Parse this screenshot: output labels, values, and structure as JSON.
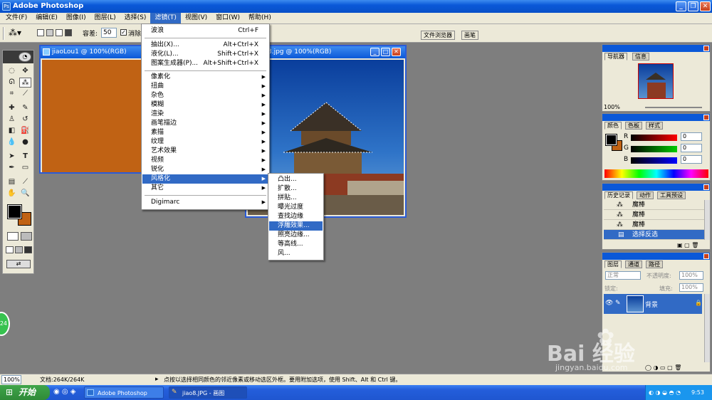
{
  "window": {
    "title": "Adobe Photoshop",
    "icon": "photoshop-app-icon"
  },
  "menubar": [
    "文件(F)",
    "编辑(E)",
    "图像(I)",
    "图层(L)",
    "选择(S)",
    "滤镜(T)",
    "视图(V)",
    "窗口(W)",
    "帮助(H)"
  ],
  "options": {
    "tolerance_label": "容差:",
    "tolerance_value": "50",
    "antialias_label": "消除",
    "dock_tabs": [
      "文件浏览器",
      "画笔"
    ]
  },
  "docs": {
    "doc1_title": "jiaoLou1 @ 100%(RGB)",
    "doc1_fill": "#c06214",
    "doc2_title": "3.jpg @ 100%(RGB)"
  },
  "filter_menu": {
    "top": [
      {
        "label": "波浪",
        "shortcut": "Ctrl+F"
      }
    ],
    "group2": [
      {
        "label": "抽出(X)...",
        "shortcut": "Alt+Ctrl+X"
      },
      {
        "label": "液化(L)...",
        "shortcut": "Shift+Ctrl+X"
      },
      {
        "label": "图案生成器(P)...",
        "shortcut": "Alt+Shift+Ctrl+X"
      }
    ],
    "group3": [
      "像素化",
      "扭曲",
      "杂色",
      "模糊",
      "渲染",
      "画笔描边",
      "素描",
      "纹理",
      "艺术效果",
      "视频",
      "锐化",
      "风格化",
      "其它"
    ],
    "group4": [
      "Digimarc"
    ],
    "highlighted": "风格化"
  },
  "stylize_menu": {
    "items": [
      "凸出...",
      "扩散...",
      "拼贴...",
      "曝光过度",
      "查找边缘",
      "浮雕效果...",
      "照亮边缘...",
      "等高线...",
      "风..."
    ],
    "highlighted": "浮雕效果..."
  },
  "navigator": {
    "tabs": [
      "导航器",
      "信息"
    ],
    "zoom": "100%"
  },
  "color": {
    "tabs": [
      "颜色",
      "色板",
      "样式"
    ],
    "r_label": "R",
    "g_label": "G",
    "b_label": "B",
    "r": "0",
    "g": "0",
    "b": "0",
    "fg": "#000000",
    "bg": "#c06214"
  },
  "history": {
    "tabs": [
      "历史记录",
      "动作",
      "工具预设"
    ],
    "items": [
      "魔棒",
      "魔棒",
      "魔棒",
      "选择反选"
    ]
  },
  "layers": {
    "tabs": [
      "图层",
      "通道",
      "路径"
    ],
    "blend": "正常",
    "opacity_label": "不透明度:",
    "opacity": "100%",
    "lock_label": "锁定:",
    "fill_label": "填充:",
    "fill": "100%",
    "layer_name": "背景"
  },
  "status": {
    "zoom": "100%",
    "doc": "文档:264K/264K",
    "hint": "点按以选择相同颜色的邻近像素或移动选区外框。要用附加选项，使用 Shift、Alt 和 Ctrl 键。"
  },
  "taskbar": {
    "start": "开始",
    "tasks": [
      "Adobe Photoshop",
      "jiao8.JPG - 画图"
    ],
    "clock": "9:53"
  },
  "watermark": {
    "text": "Bai 经验",
    "url": "jingyan.baidu.com"
  },
  "green_bubble": "24"
}
